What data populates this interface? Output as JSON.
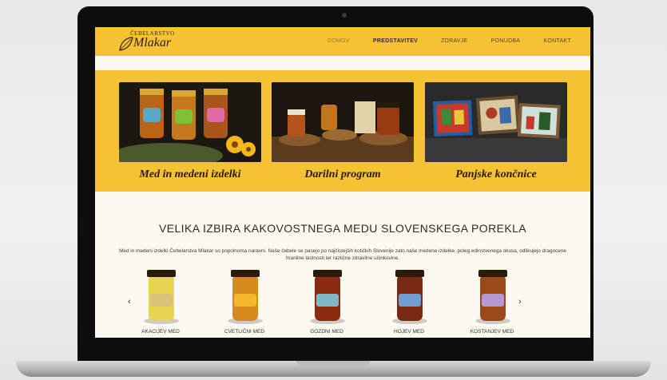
{
  "site": {
    "logo": {
      "small": "ČEBELARSTVO",
      "big": "Mlakar"
    },
    "nav": [
      {
        "label": "DOMOV"
      },
      {
        "label": "PREDSTAVITEV"
      },
      {
        "label": "ZDRAVJE"
      },
      {
        "label": "PONUDBA"
      },
      {
        "label": "KONTAKT"
      }
    ]
  },
  "banner": {
    "cards": [
      {
        "title": "Med in medeni izdelki"
      },
      {
        "title": "Darilni program"
      },
      {
        "title": "Panjske končnice"
      }
    ]
  },
  "main": {
    "headline": "VELIKA IZBIRA KAKOVOSTNEGA MEDU SLOVENSKEGA POREKLA",
    "intro": "Med in medeni izdelki Čebelarstva Mlakar so popolnoma naravni. Naše čebele se pasejo po najčistejših kotičkih Slovenije zato naše medene izdelke, poleg edinstvenega okusa, odlikujejo dragocene hranilne lastnosti ter različne zdravilne učinkovine.",
    "prev_arrow": "‹",
    "next_arrow": "›",
    "products": [
      {
        "name": "AKACIJEV MED",
        "color": "#e8d451"
      },
      {
        "name": "CVETLIČNI MED",
        "color": "#d98a1e"
      },
      {
        "name": "GOZDNI MED",
        "color": "#8c2a10"
      },
      {
        "name": "HOJEV MED",
        "color": "#7a2a12"
      },
      {
        "name": "KOSTANJEV MED",
        "color": "#9a4a1a"
      }
    ]
  },
  "colors": {
    "accent": "#f5c233"
  }
}
